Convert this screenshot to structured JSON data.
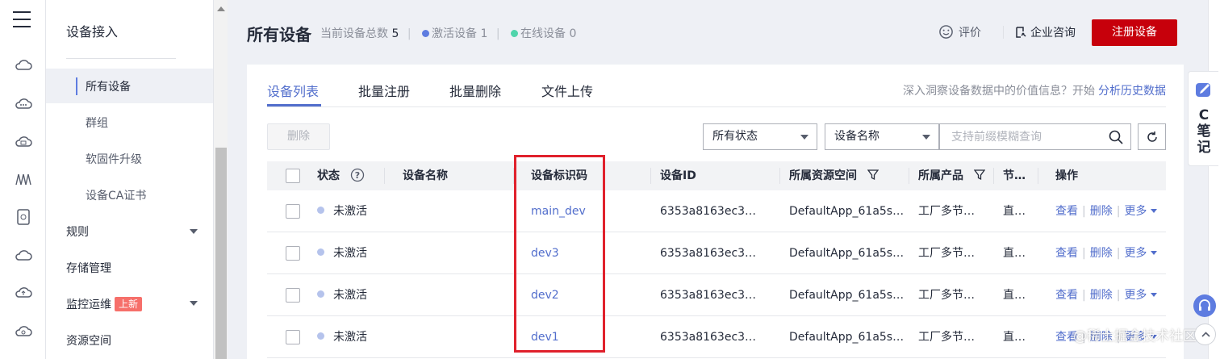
{
  "rail": {
    "icons": [
      "menu-icon",
      "cloud-icon",
      "cloud-dots-icon",
      "cloud-square-icon",
      "wave-icon",
      "device-icon",
      "cloud-outline-icon",
      "cloud-upload-icon",
      "cloud-gear-icon"
    ]
  },
  "nav": {
    "title": "设备接入",
    "items": [
      {
        "label": "所有设备"
      },
      {
        "label": "群组"
      },
      {
        "label": "软固件升级"
      },
      {
        "label": "设备CA证书"
      },
      {
        "label": "规则"
      },
      {
        "label": "存储管理"
      },
      {
        "label": "监控运维",
        "badge": "上新"
      },
      {
        "label": "资源空间"
      }
    ]
  },
  "header": {
    "title": "所有设备",
    "total_label": "当前设备总数",
    "total_value": "5",
    "active_label": "激活设备",
    "active_value": "1",
    "online_label": "在线设备",
    "online_value": "0",
    "active_color": "#5e7ce0",
    "online_color": "#50d4ab",
    "rate_label": "评价",
    "consult_label": "企业咨询",
    "register_label": "注册设备"
  },
  "tabs": [
    "设备列表",
    "批量注册",
    "批量删除",
    "文件上传"
  ],
  "insight": {
    "text": "深入洞察设备数据中的价值信息？开始",
    "link": "分析历史数据"
  },
  "toolbar": {
    "delete_label": "删除",
    "status_select": "所有状态",
    "field_select": "设备名称",
    "search_placeholder": "支持前缀模糊查询"
  },
  "table": {
    "headers": {
      "status": "状态",
      "name": "设备名称",
      "node_id": "设备标识码",
      "device_id": "设备ID",
      "space": "所属资源空间",
      "product": "所属产品",
      "node_type": "节…",
      "ops": "操作"
    },
    "rows": [
      {
        "status": "未激活",
        "name": "",
        "node_id": "main_dev",
        "device_id": "6353a8163ec3…",
        "space": "DefaultApp_61a5s…",
        "product": "工厂多节…",
        "node_type": "直…"
      },
      {
        "status": "未激活",
        "name": "",
        "node_id": "dev3",
        "device_id": "6353a8163ec3…",
        "space": "DefaultApp_61a5s…",
        "product": "工厂多节…",
        "node_type": "直…"
      },
      {
        "status": "未激活",
        "name": "",
        "node_id": "dev2",
        "device_id": "6353a8163ec3…",
        "space": "DefaultApp_61a5s…",
        "product": "工厂多节…",
        "node_type": "直…"
      },
      {
        "status": "未激活",
        "name": "",
        "node_id": "dev1",
        "device_id": "6353a8163ec3…",
        "space": "DefaultApp_61a5s…",
        "product": "工厂多节…",
        "node_type": "直…"
      }
    ],
    "ops": {
      "view": "查看",
      "delete": "删除",
      "more": "更多"
    }
  },
  "float": {
    "note": "C笔记"
  },
  "watermark": "@稀土掘金技术社区"
}
